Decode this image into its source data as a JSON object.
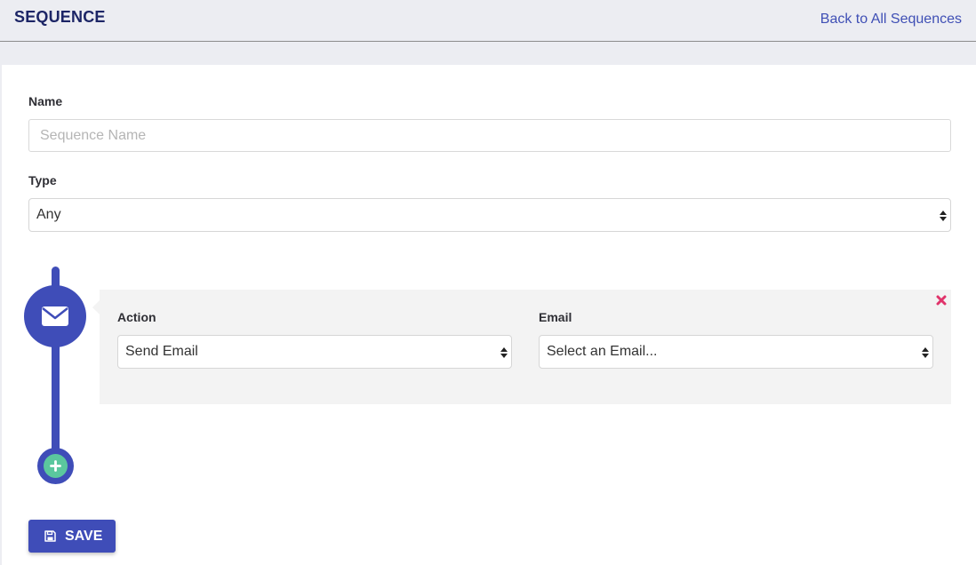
{
  "header": {
    "title": "SEQUENCE",
    "back_link": "Back to All Sequences"
  },
  "form": {
    "name_label": "Name",
    "name_placeholder": "Sequence Name",
    "name_value": "",
    "type_label": "Type",
    "type_value": "Any"
  },
  "steps": [
    {
      "icon": "envelope-icon",
      "action_label": "Action",
      "action_value": "Send Email",
      "email_label": "Email",
      "email_value": "Select an Email..."
    }
  ],
  "save_label": "SAVE",
  "colors": {
    "accent": "#3f4db8",
    "title": "#1c2566",
    "link": "#3f4fb5",
    "add_green": "#5bc79e",
    "remove_red": "#e0336a",
    "panel_bg": "#f3f3f3"
  }
}
